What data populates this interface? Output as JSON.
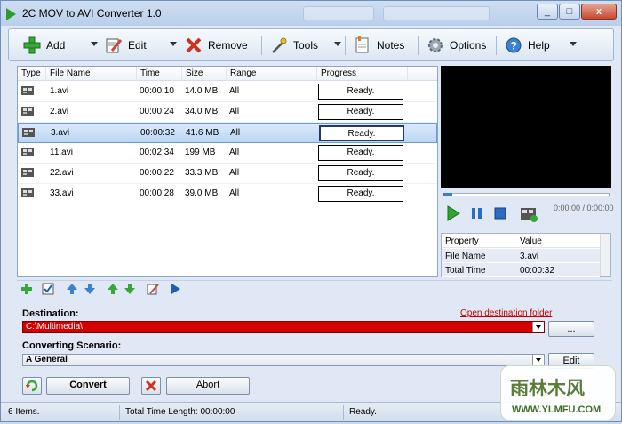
{
  "window": {
    "title": "2C MOV to AVI Converter 1.0",
    "min": "_",
    "max": "□",
    "close": "x"
  },
  "toolbar": {
    "add": "Add",
    "edit": "Edit",
    "remove": "Remove",
    "tools": "Tools",
    "notes": "Notes",
    "options": "Options",
    "help": "Help"
  },
  "list": {
    "columns": [
      "Type",
      "File Name",
      "Time",
      "Size",
      "Range",
      "Progress"
    ],
    "rows": [
      {
        "name": "1.avi",
        "time": "00:00:10",
        "size": "14.0 MB",
        "range": "All",
        "progress": "Ready."
      },
      {
        "name": "2.avi",
        "time": "00:00:24",
        "size": "34.0 MB",
        "range": "All",
        "progress": "Ready."
      },
      {
        "name": "3.avi",
        "time": "00:00:32",
        "size": "41.6 MB",
        "range": "All",
        "progress": "Ready."
      },
      {
        "name": "11.avi",
        "time": "00:02:34",
        "size": "199 MB",
        "range": "All",
        "progress": "Ready."
      },
      {
        "name": "22.avi",
        "time": "00:00:22",
        "size": "33.3 MB",
        "range": "All",
        "progress": "Ready."
      },
      {
        "name": "33.avi",
        "time": "00:00:28",
        "size": "39.0 MB",
        "range": "All",
        "progress": "Ready."
      }
    ],
    "selected_index": 2
  },
  "player": {
    "time": "0:00:00 / 0:00:00"
  },
  "properties": {
    "headers": [
      "Property",
      "Value"
    ],
    "rows": [
      {
        "property": "File Name",
        "value": "3.avi"
      },
      {
        "property": "Total Time",
        "value": "00:00:32"
      }
    ]
  },
  "destination": {
    "label": "Destination:",
    "open_link": "Open destination folder",
    "path": "C:\\Multimedia\\",
    "browse": "...",
    "color": "#d40000"
  },
  "scenario": {
    "label": "Converting Scenario:",
    "value": "A General",
    "edit": "Edit"
  },
  "actions": {
    "convert": "Convert",
    "abort": "Abort"
  },
  "status": {
    "items": "6 Items.",
    "total": "Total Time Length: 00:00:00",
    "state": "Ready."
  },
  "watermark": {
    "text": "雨林木风",
    "sub": "WWW.YLMFU.COM"
  },
  "colors": {
    "accent_green": "#2e9a2e",
    "selection": "#bcd6f3",
    "remove_red": "#d0311f"
  }
}
